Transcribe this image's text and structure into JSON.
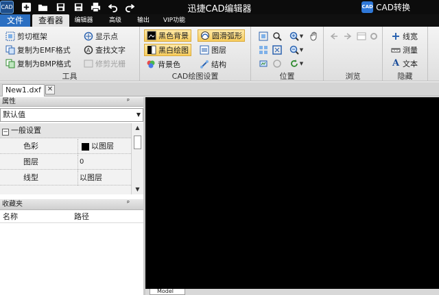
{
  "app": {
    "title": "迅捷CAD编辑器",
    "logo_text": "CAD",
    "convert_label": "CAD转换",
    "convert_badge": "CAD"
  },
  "quick_access": [
    "new-icon",
    "open-folder-icon",
    "save-icon",
    "save-as-icon",
    "print-icon",
    "undo-icon",
    "redo-icon"
  ],
  "menu": {
    "file": "文件",
    "tabs": [
      "查看器",
      "编辑器",
      "高级",
      "输出",
      "VIP功能"
    ]
  },
  "ribbon": {
    "tools": {
      "label": "工具",
      "items": [
        "剪切框架",
        "复制为EMF格式",
        "复制为BMP格式",
        "显示点",
        "查找文字",
        "修剪光栅"
      ]
    },
    "cad_settings": {
      "label": "CAD绘图设置",
      "items": [
        "黑色背景",
        "黑白绘图",
        "背景色",
        "圆滑弧形",
        "图层",
        "结构"
      ]
    },
    "position": {
      "label": "位置"
    },
    "browse": {
      "label": "浏览"
    },
    "hide": {
      "label": "隐藏",
      "items": [
        "线宽",
        "测量",
        "文本"
      ]
    }
  },
  "document_tab": {
    "name": "New1.dxf",
    "close": "✕"
  },
  "properties": {
    "title": "属性",
    "pin": "ᵖ",
    "selector": "默认值",
    "group": "一般设置",
    "rows": [
      {
        "name": "色彩",
        "value": "以图层"
      },
      {
        "name": "图层",
        "value": "0"
      },
      {
        "name": "线型",
        "value": "以图层"
      }
    ]
  },
  "favorites": {
    "title": "收藏夹",
    "pin": "ᵖ",
    "columns": [
      "名称",
      "路径"
    ]
  },
  "model_tab": "Model",
  "colors": {
    "titlebar": "#0c0c0c",
    "file_tab": "#2b6fc2",
    "highlight": "#f7cc5c",
    "canvas": "#000000"
  }
}
